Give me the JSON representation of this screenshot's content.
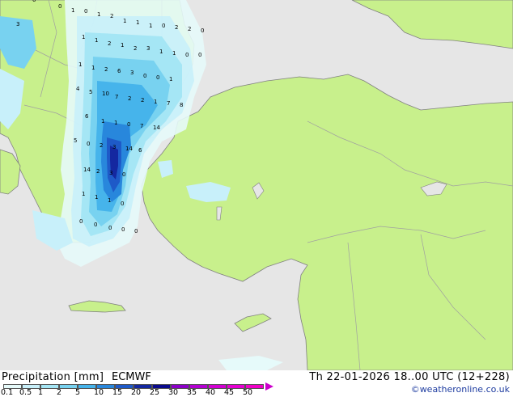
{
  "title": "Precipitation [mm]",
  "model": "ECMWF",
  "datetime": "Th 22-01-2026 18..00 UTC (12+228)",
  "credit": "©weatheronline.co.uk",
  "colors": {
    "sea": "#e6e6e6",
    "land": "#c8f08c",
    "border": "#a0a0a0",
    "coast": "#808080"
  },
  "scale": {
    "labels": [
      "0.1",
      "0.5",
      "1",
      "2",
      "5",
      "10",
      "15",
      "20",
      "25",
      "30",
      "35",
      "40",
      "45",
      "50"
    ],
    "colors": [
      "#e6fafa",
      "#c8f0fa",
      "#a5e6f5",
      "#78d2f0",
      "#46b4eb",
      "#2887dc",
      "#1e5ac8",
      "#1428a0",
      "#0a0a8c",
      "#8c00c8",
      "#b400d2",
      "#d200d2",
      "#e600d2",
      "#f000c8"
    ]
  },
  "map_values": [
    "0",
    "0",
    "1",
    "0",
    "1",
    "2",
    "1",
    "1",
    "1",
    "0",
    "2",
    "2",
    "0",
    "3",
    "1",
    "1",
    "2",
    "1",
    "2",
    "3",
    "1",
    "1",
    "0",
    "0",
    "1",
    "1",
    "2",
    "6",
    "3",
    "0",
    "0",
    "1",
    "4",
    "5",
    "10",
    "7",
    "2",
    "2",
    "1",
    "7",
    "8",
    "6",
    "1",
    "1",
    "0",
    "7",
    "14",
    "5",
    "0",
    "2",
    "3",
    "14",
    "6",
    "14",
    "2",
    "3",
    "0",
    "1",
    "1",
    "1",
    "0",
    "0",
    "0",
    "0",
    "0",
    "0"
  ]
}
